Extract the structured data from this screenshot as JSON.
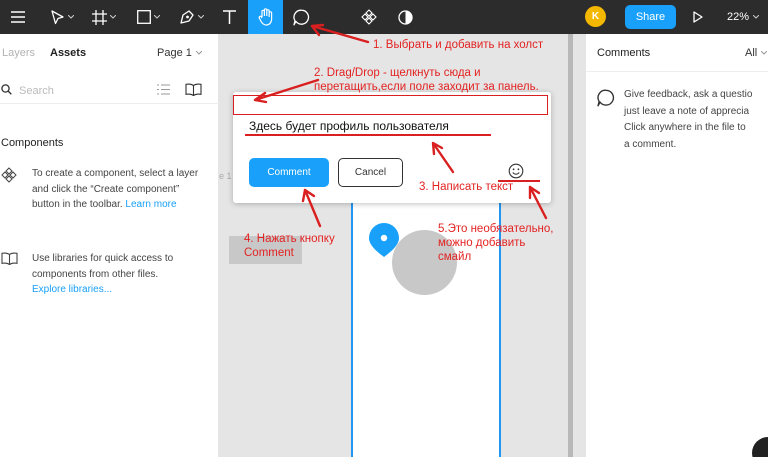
{
  "toolbar": {
    "avatar_initial": "K",
    "share_label": "Share",
    "zoom": "22%",
    "icons": [
      "menu-icon",
      "move-tool-icon",
      "frame-tool-icon",
      "shape-tool-icon",
      "pen-tool-icon",
      "text-tool-icon",
      "hand-tool-icon",
      "comment-tool-icon",
      "components-icon",
      "contrast-icon",
      "play-icon"
    ],
    "accent_color": "#18a0fb"
  },
  "left_panel": {
    "tab_layers": "Layers",
    "tab_assets": "Assets",
    "page_selector": "Page 1",
    "search_placeholder": "Search",
    "components_heading": "Components",
    "create_text": "To create a component, select a layer and click the “Create component” button in the toolbar.",
    "create_link": "Learn more",
    "libraries_text": "Use libraries for quick access to components from other files.",
    "libraries_link": "Explore libraries..."
  },
  "canvas": {
    "frame_label_fragment": "e 1"
  },
  "comment_popup": {
    "input_value": "Здесь будет профиль пользователя",
    "comment_button": "Comment",
    "cancel_button": "Cancel"
  },
  "right_panel": {
    "title": "Comments",
    "filter": "All",
    "empty_lines": [
      "Give feedback, ask a questio",
      "just leave a note of apprecia",
      "Click anywhere in the file to",
      "a comment."
    ]
  },
  "annotations": {
    "step1": "1. Выбрать и добавить на холст",
    "step2_line1": "2. Drag/Drop - щелкнуть сюда и",
    "step2_line2": "перетащить,если поле заходит за панель.",
    "step3": "3. Написать текст",
    "step4_line1": "4. Нажать кнопку",
    "step4_line2": "Comment",
    "step5_line1": "5.Это необязательно,",
    "step5_line2": "можно добавить",
    "step5_line3": "смайл",
    "annotation_color": "#e32222"
  }
}
